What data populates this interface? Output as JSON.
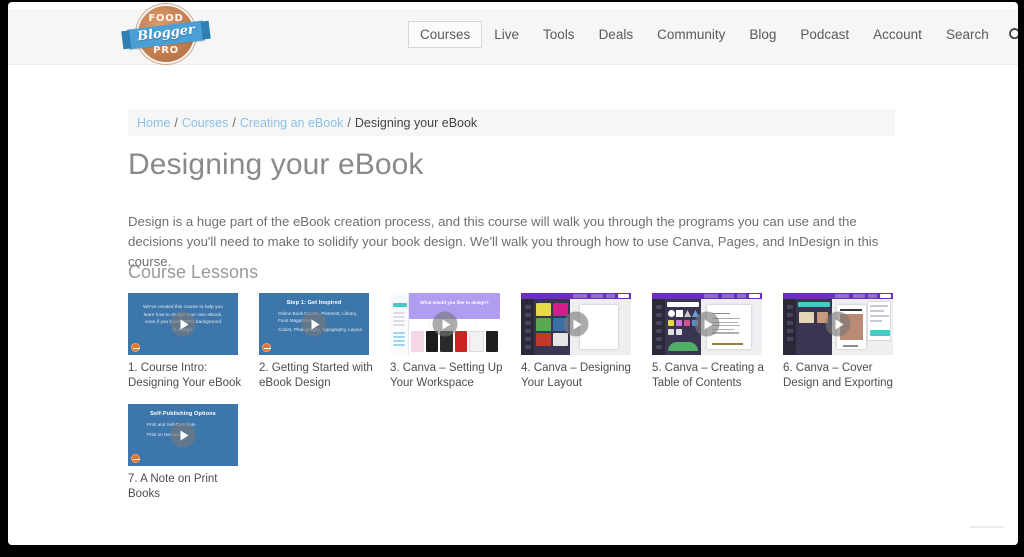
{
  "site": {
    "logo": {
      "top_word": "FOOD",
      "ribbon_word": "Blogger",
      "bottom_word": "PRO",
      "circle_color": "#c07c4e",
      "ribbon_color": "#4a9fd4"
    },
    "nav": {
      "items": [
        {
          "label": "Courses",
          "active": true
        },
        {
          "label": "Live",
          "active": false
        },
        {
          "label": "Tools",
          "active": false
        },
        {
          "label": "Deals",
          "active": false
        },
        {
          "label": "Community",
          "active": false
        },
        {
          "label": "Blog",
          "active": false
        },
        {
          "label": "Podcast",
          "active": false
        },
        {
          "label": "Account",
          "active": false
        },
        {
          "label": "Search",
          "active": false
        }
      ],
      "search_icon": "search-icon"
    }
  },
  "breadcrumb": {
    "items": [
      {
        "label": "Home",
        "is_link": true
      },
      {
        "label": "Courses",
        "is_link": true
      },
      {
        "label": "Creating an eBook",
        "is_link": true
      },
      {
        "label": "Designing your eBook",
        "is_link": false
      }
    ],
    "separator": "/",
    "link_color": "#8cc2e8"
  },
  "page": {
    "title": "Designing your eBook",
    "description": "Design is a huge part of the eBook creation process, and this course will walk you through the programs you can use and the decisions you'll need to make to solidify your book design. We'll walk you through how to use Canva, Pages, and InDesign in this course.",
    "lessons_heading": "Course Lessons"
  },
  "lessons": [
    {
      "label": "1. Course Intro: Designing Your eBook",
      "thumb_type": "slide",
      "slide": {
        "title": "",
        "body": "We've created this course to help you learn how to design your own eBook, even if you have ZERO background in design.",
        "bullets": [],
        "bg_color": "#3d76ab"
      }
    },
    {
      "label": "2. Getting Started with eBook Design",
      "thumb_type": "slide",
      "slide": {
        "title": "Step 1: Get Inspired",
        "body": "",
        "bullets": [
          "Online Book Covers, Pinterest, Library, Food Magazines",
          "Colors, Photography, Typography, Layout"
        ],
        "bg_color": "#3d76ab"
      }
    },
    {
      "label": "3. Canva – Setting Up Your Workspace",
      "thumb_type": "canva-home",
      "hero_text": "What would you like to design?"
    },
    {
      "label": "4. Canva – Designing Your Layout",
      "thumb_type": "canva-editor-templates"
    },
    {
      "label": "5. Canva – Creating a Table of Contents",
      "thumb_type": "canva-editor-toc"
    },
    {
      "label": "6. Canva – Cover Design and Exporting",
      "thumb_type": "canva-editor-cover"
    },
    {
      "label": "7. A Note on Print Books",
      "thumb_type": "slide",
      "slide": {
        "title": "Self-Publishing Options",
        "body": "",
        "bullets": [
          "Print and Self-Distribute",
          "Print on Demand"
        ],
        "bg_color": "#3d76ab"
      }
    }
  ]
}
